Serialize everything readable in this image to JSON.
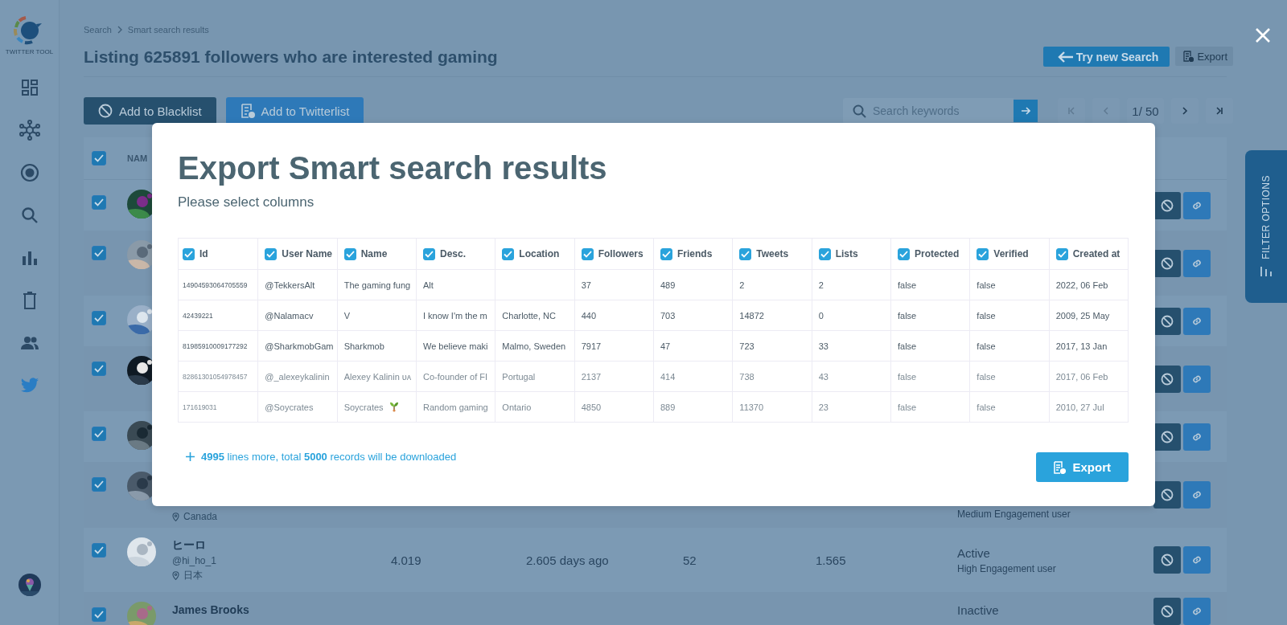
{
  "sidebar": {
    "logo_text": "TWITTER TOOL",
    "items": [
      {
        "kind": "dashboard",
        "selected": false
      },
      {
        "kind": "network",
        "selected": false
      },
      {
        "kind": "target",
        "selected": false
      },
      {
        "kind": "search",
        "selected": false
      },
      {
        "kind": "chart",
        "selected": false
      },
      {
        "kind": "trash",
        "selected": false
      },
      {
        "kind": "users",
        "selected": false
      },
      {
        "kind": "twitter",
        "selected": true
      }
    ]
  },
  "breadcrumb": [
    {
      "label": "Search"
    },
    {
      "label": "Smart search results"
    }
  ],
  "title": "Listing 625891 followers who are interested gaming",
  "header_buttons": {
    "try_new_search": "Try new Search",
    "export": "Export"
  },
  "actions": [
    {
      "kind": "blacklist",
      "label": "Add to Blacklist"
    },
    {
      "kind": "twitterlist",
      "label": "Add to Twitterlist"
    }
  ],
  "search": {
    "placeholder": "Search keywords"
  },
  "pagination": {
    "page": "1/ 50"
  },
  "table": {
    "select_all_checked": true,
    "column_1": "NAM",
    "rows": [
      {
        "checked": true
      },
      {
        "checked": true
      },
      {
        "checked": true
      },
      {
        "checked": true
      },
      {
        "checked": true
      },
      {
        "checked": true,
        "location": "Canada",
        "engagement": "Medium Engagement user"
      },
      {
        "checked": true,
        "name": "ヒーロ",
        "handle": "@hi_ho_1",
        "location": "日本",
        "followers": "4.019",
        "last_tweet": "2.605 days ago",
        "friends": "52",
        "lists": "1.565",
        "status": "Active",
        "engagement": "High Engagement user"
      },
      {
        "checked": true,
        "name": "James Brooks",
        "status": "Inactive"
      }
    ]
  },
  "filter_tab": "FILTER OPTIONS",
  "modal": {
    "title": "Export Smart search results",
    "subtitle": "Please select columns",
    "columns": [
      {
        "label": "Id",
        "checked": true
      },
      {
        "label": "User Name",
        "checked": true
      },
      {
        "label": "Name",
        "checked": true
      },
      {
        "label": "Desc.",
        "checked": true
      },
      {
        "label": "Location",
        "checked": true
      },
      {
        "label": "Followers",
        "checked": true
      },
      {
        "label": "Friends",
        "checked": true
      },
      {
        "label": "Tweets",
        "checked": true
      },
      {
        "label": "Lists",
        "checked": true
      },
      {
        "label": "Protected",
        "checked": true
      },
      {
        "label": "Verified",
        "checked": true
      },
      {
        "label": "Created at",
        "checked": true
      }
    ],
    "rows": [
      {
        "kind": "plain",
        "cells": [
          "14904593064705559",
          "@TekkersAlt",
          "The gaming fung",
          "Alt",
          "",
          "37",
          "489",
          "2",
          "2",
          "false",
          "false",
          "2022, 06 Feb"
        ]
      },
      {
        "kind": "plain",
        "cells": [
          "42439221",
          "@Nalamacv",
          "V",
          "I know I'm the m",
          "Charlotte, NC",
          "440",
          "703",
          "14872",
          "0",
          "false",
          "false",
          "2009, 25 May"
        ]
      },
      {
        "kind": "plain",
        "cells": [
          "81985910009177292",
          "@SharkmobGam",
          "Sharkmob",
          "We believe maki",
          "Malmo, Sweden",
          "7917",
          "47",
          "723",
          "33",
          "false",
          "false",
          "2017, 13 Jan"
        ]
      },
      {
        "kind": "plain",
        "cells": [
          "82861301054978457",
          "@_alexeykalinin",
          "Alexey Kalinin ᴜᴀ",
          "Co-founder of FI",
          "Portugal",
          "2137",
          "414",
          "738",
          "43",
          "false",
          "false",
          "2017, 06 Feb"
        ]
      },
      {
        "kind": "sprout",
        "cells": [
          "171619031",
          "@Soycrates",
          "Soycrates",
          "Random gaming",
          "Ontario",
          "4850",
          "889",
          "11370",
          "23",
          "false",
          "false",
          "2010, 27 Jul"
        ]
      }
    ],
    "more_text": "**4995** lines more, total **5000** records will be downloaded",
    "export_button": "Export"
  }
}
